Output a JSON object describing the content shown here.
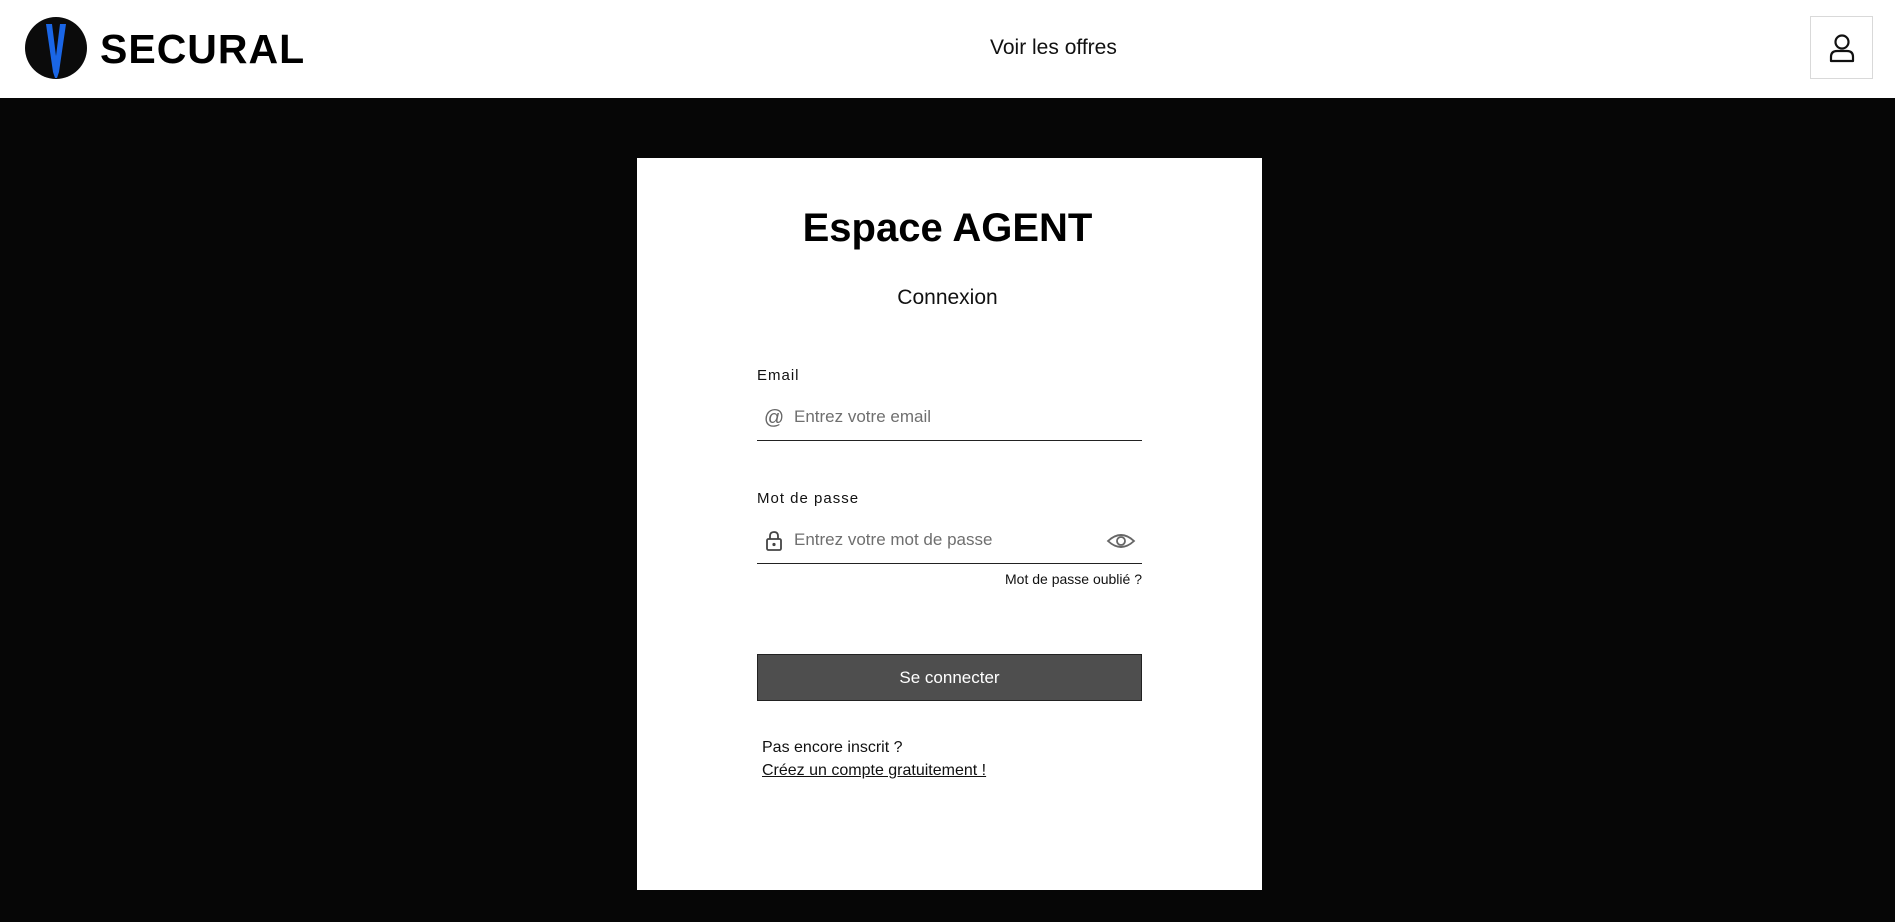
{
  "header": {
    "brand": "SECURAL",
    "nav_offers": "Voir les offres",
    "logo_icon": "shield-v-logo",
    "user_icon": "user-icon"
  },
  "login": {
    "title": "Espace AGENT",
    "subtitle": "Connexion",
    "email": {
      "label": "Email",
      "placeholder": "Entrez votre email",
      "value": "",
      "icon": "at-icon"
    },
    "password": {
      "label": "Mot de passe",
      "placeholder": "Entrez votre mot de passe",
      "value": "",
      "icon": "lock-icon",
      "toggle_icon": "eye-icon"
    },
    "forgot": "Mot de passe oublié ?",
    "submit": "Se connecter",
    "signup_question": "Pas encore inscrit ?",
    "signup_link": "Créez un compte gratuitement !"
  },
  "colors": {
    "background": "#060606",
    "card": "#ffffff",
    "button": "#4e4e4e",
    "logo_accent": "#1a66e6"
  }
}
